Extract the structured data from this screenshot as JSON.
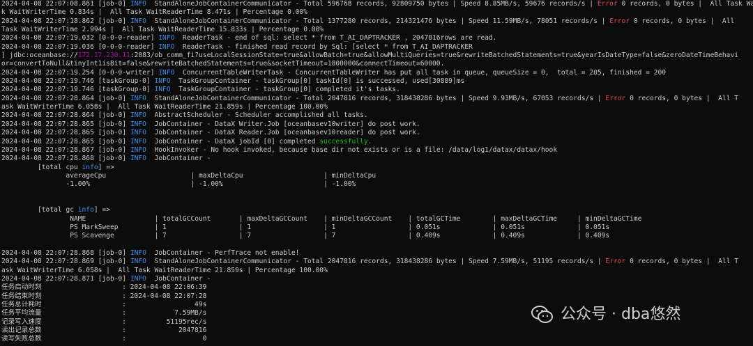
{
  "colors": {
    "background": "#0c0c0c",
    "text": "#cccccc",
    "info": "#3b8eea",
    "error": "#e74856",
    "success": "#16c60c",
    "ip": "#b4009e"
  },
  "log": [
    [
      {
        "t": "2024-04-08 22:07:08.861 [job-0] "
      },
      {
        "t": "INFO",
        "c": "info"
      },
      {
        "t": "  StandAloneJobContainerCommunicator - Total 596768 records, 92809750 bytes | Speed 8.85MB/s, 59676 records/s | "
      },
      {
        "t": "Error",
        "c": "err"
      },
      {
        "t": " 0 records, 0 bytes |  All Task WaitWriterTime 0.834s |  All Task WaitReaderTime 8.471s | Percentage 0.00%"
      }
    ],
    [
      {
        "t": "k WaitWriterTime 0.834s |  All Task WaitReaderTime 8.471s | Percentage 0.00%"
      }
    ],
    [
      {
        "t": "2024-04-08 22:07:18.862 [job-0] "
      },
      {
        "t": "INFO",
        "c": "info"
      },
      {
        "t": "  StandAloneJobContainerCommunicator - Total 1377280 records, 214321476 bytes | Speed 11.59MB/s, 78051 records/s | "
      },
      {
        "t": "Error",
        "c": "err"
      },
      {
        "t": " 0 records, 0 bytes |  All"
      }
    ],
    [
      {
        "t": "Task WaitWriterTime 2.994s |  All Task WaitReaderTime 15.833s | Percentage 0.00%"
      }
    ],
    [
      {
        "t": "2024-04-08 22:07:19.032 [0-0-0-reader] "
      },
      {
        "t": "INFO",
        "c": "info"
      },
      {
        "t": "  ReaderTask - end of sql: select * from T_AI_DAPTRACKER , 2047816rows are read."
      }
    ],
    [
      {
        "t": "2024-04-08 22:07:19.036 [0-0-0-reader] "
      },
      {
        "t": "INFO",
        "c": "info"
      },
      {
        "t": "  ReaderTask - finished read record by Sql: [select * from T_AI_DAPTRACKER"
      }
    ],
    [
      {
        "t": "] jdbc:oceanbase://"
      },
      {
        "t": "172.17.230.11",
        "c": "ip"
      },
      {
        "t": ":2883/ob_comm_fi?useLocalSessionState=true&allowBatch=true&allowMultiQueries=true&rewriteBatchedStatements=true&yearIsDateType=false&zeroDateTimeBehavi"
      }
    ],
    [
      {
        "t": "or=convertToNull&tinyInt1isBit=false&rewriteBatchedStatements=true&socketTimeout=1800000&connectTimeout=60000."
      }
    ],
    [
      {
        "t": "2024-04-08 22:07:19.254 [0-0-0-writer] "
      },
      {
        "t": "INFO",
        "c": "info"
      },
      {
        "t": "  ConcurrentTableWriterTask - ConcurrentTableWriter has put all task in queue, queueSize = 0,  total = 205, finished = 200"
      }
    ],
    [
      {
        "t": "2024-04-08 22:07:19.746 [taskGroup-0] "
      },
      {
        "t": "INFO",
        "c": "info"
      },
      {
        "t": "  TaskGroupContainer - taskGroup[0] taskId[0] is successed, used[30889]ms"
      }
    ],
    [
      {
        "t": "2024-04-08 22:07:19.746 [taskGroup-0] "
      },
      {
        "t": "INFO",
        "c": "info"
      },
      {
        "t": "  TaskGroupContainer - taskGroup[0] completed it's tasks."
      }
    ],
    [
      {
        "t": "2024-04-08 22:07:28.864 [job-0] "
      },
      {
        "t": "INFO",
        "c": "info"
      },
      {
        "t": "  StandAloneJobContainerCommunicator - Total 2047816 records, 318438286 bytes | Speed 9.93MB/s, 67053 records/s | "
      },
      {
        "t": "Error",
        "c": "err"
      },
      {
        "t": " 0 records, 0 bytes |  All T"
      }
    ],
    [
      {
        "t": "ask WaitWriterTime 6.058s |  All Task WaitReaderTime 21.859s | Percentage 100.00%"
      }
    ],
    [
      {
        "t": "2024-04-08 22:07:28.864 [job-0] "
      },
      {
        "t": "INFO",
        "c": "info"
      },
      {
        "t": "  AbstractScheduler - Scheduler accomplished all tasks."
      }
    ],
    [
      {
        "t": "2024-04-08 22:07:28.865 [job-0] "
      },
      {
        "t": "INFO",
        "c": "info"
      },
      {
        "t": "  JobContainer - DataX Writer.Job [oceanbasev10writer] do post work."
      }
    ],
    [
      {
        "t": "2024-04-08 22:07:28.865 [job-0] "
      },
      {
        "t": "INFO",
        "c": "info"
      },
      {
        "t": "  JobContainer - DataX Reader.Job [oceanbasev10reader] do post work."
      }
    ],
    [
      {
        "t": "2024-04-08 22:07:28.865 [job-0] "
      },
      {
        "t": "INFO",
        "c": "info"
      },
      {
        "t": "  JobContainer - DataX jobId [0] completed "
      },
      {
        "t": "successfully.",
        "c": "ok"
      }
    ],
    [
      {
        "t": "2024-04-08 22:07:28.867 [job-0] "
      },
      {
        "t": "INFO",
        "c": "info"
      },
      {
        "t": "  HookInvoker - No hook invoked, because base dir not exists or is a file: /data/log1/datax/datax/hook"
      }
    ],
    [
      {
        "t": "2024-04-08 22:07:28.868 [job-0] "
      },
      {
        "t": "INFO",
        "c": "info"
      },
      {
        "t": "  JobContainer -"
      }
    ],
    [
      {
        "t": "         [total cpu "
      },
      {
        "t": "info",
        "c": "info"
      },
      {
        "t": "] =>"
      }
    ],
    [
      {
        "t": "                averageCpu                     | maxDeltaCpu                    | minDeltaCpu"
      }
    ],
    [
      {
        "t": "                -1.00%                         | -1.00%                         | -1.00%"
      }
    ],
    [
      {
        "t": ""
      }
    ],
    [
      {
        "t": ""
      }
    ],
    [
      {
        "t": "         [total gc "
      },
      {
        "t": "info",
        "c": "info"
      },
      {
        "t": "] =>"
      }
    ],
    [
      {
        "t": "                 NAME                 | totalGCCount       | maxDeltaGCCount    | minDeltaGCCount    | totalGCTime        | maxDeltaGCTime     | minDeltaGCTime"
      }
    ],
    [
      {
        "t": "                 PS MarkSweep         | 1                  | 1                  | 1                  | 0.051s             | 0.051s             | 0.051s"
      }
    ],
    [
      {
        "t": "                 PS Scavenge          | 7                  | 7                  | 7                  | 0.409s             | 0.409s             | 0.409s"
      }
    ],
    [
      {
        "t": ""
      }
    ],
    [
      {
        "t": "2024-04-08 22:07:28.868 [job-0] "
      },
      {
        "t": "INFO",
        "c": "info"
      },
      {
        "t": "  JobContainer - PerfTrace not enable!"
      }
    ],
    [
      {
        "t": "2024-04-08 22:07:28.869 [job-0] "
      },
      {
        "t": "INFO",
        "c": "info"
      },
      {
        "t": "  StandAloneJobContainerCommunicator - Total 2047816 records, 318438286 bytes | Speed 7.59MB/s, 51195 records/s | "
      },
      {
        "t": "Error",
        "c": "err"
      },
      {
        "t": " 0 records, 0 bytes |  All T"
      }
    ],
    [
      {
        "t": "ask WaitWriterTime 6.058s |  All Task WaitReaderTime 21.859s | Percentage 100.00%"
      }
    ],
    [
      {
        "t": "2024-04-08 22:07:28.871 [job-0] "
      },
      {
        "t": "INFO",
        "c": "info"
      },
      {
        "t": "  JobContainer -"
      }
    ],
    [
      {
        "t": "任务启动时刻                    : 2024-04-08 22:06:39"
      }
    ],
    [
      {
        "t": "任务结束时刻                    : 2024-04-08 22:07:28"
      }
    ],
    [
      {
        "t": "任务总计耗时                    :                 49s"
      }
    ],
    [
      {
        "t": "任务平均流量                    :            7.59MB/s"
      }
    ],
    [
      {
        "t": "记录写入速度                    :          51195rec/s"
      }
    ],
    [
      {
        "t": "读出记录总数                    :             2047816"
      }
    ],
    [
      {
        "t": "读写失败总数                    :                   0"
      }
    ]
  ],
  "watermark": {
    "text": "公众号 · dba悠然",
    "icon": "wechat-icon"
  }
}
